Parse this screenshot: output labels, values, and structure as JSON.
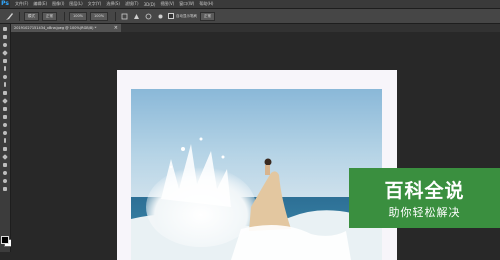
{
  "app": {
    "logo": "Ps",
    "accent": "#31a8ff"
  },
  "menubar": {
    "items": [
      "文件(F)",
      "编辑(E)",
      "图像(I)",
      "图层(L)",
      "文字(Y)",
      "选择(S)",
      "滤镜(T)",
      "3D(D)",
      "视图(V)",
      "窗口(W)",
      "帮助(H)"
    ]
  },
  "optionsbar": {
    "tool_icon": "brush-icon",
    "mode_value": "模式",
    "normal_label": "正常",
    "opacity_value": "100%",
    "flow_value": "100%",
    "sample_label": "自动显示笔刷",
    "checkbox_label": "对所有图层取样",
    "last_box": "正常"
  },
  "document": {
    "tab_title": "20191027151434_xBrw.jpeg @ 100%(RGB/8) *",
    "close_glyph": "×"
  },
  "colors": {
    "foreground": "#000000",
    "background": "#ffffff",
    "canvas_bg": "#282828",
    "watermark_bg": "#3a8f3f"
  },
  "watermark": {
    "title": "百科全说",
    "subtitle": "助你轻松解决"
  }
}
